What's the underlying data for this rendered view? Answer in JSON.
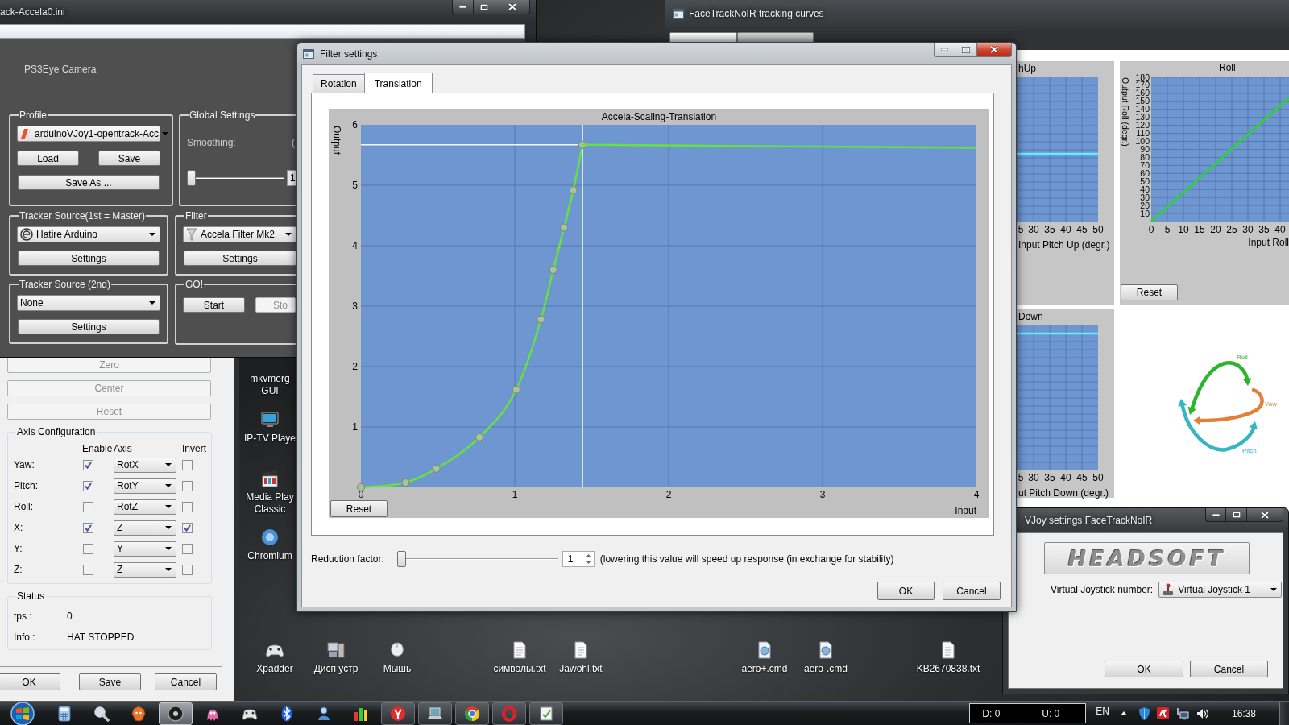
{
  "main_window": {
    "title": "ack-Accela0.ini",
    "camera_label": "PS3Eye Camera",
    "profile": {
      "label": "Profile",
      "dropdown": "arduinoVJoy1-opentrack-Acc",
      "buttons": [
        "Load",
        "Save",
        "Save As ..."
      ]
    },
    "global_settings": {
      "label": "Global Settings",
      "smoothing_label": "Smoothing:",
      "unit_label": "(",
      "slider": {
        "level": 0
      },
      "spin_value": "1"
    },
    "tracker_source_1": {
      "label": "Tracker Source(1st = Master)",
      "dropdown": "Hatire Arduino",
      "button": "Settings"
    },
    "filter": {
      "label": "Filter",
      "dropdown": "Accela Filter Mk2",
      "button": "Settings"
    },
    "tracker_source_2": {
      "label": "Tracker Source (2nd)",
      "dropdown": "None",
      "button": "Settings"
    },
    "go": {
      "label": "GO!",
      "buttons": [
        {
          "label": "Start",
          "disabled": false
        },
        {
          "label": "Sto",
          "disabled": true
        }
      ]
    }
  },
  "hat_window": {
    "buttons": [
      {
        "label": "Zero",
        "disabled": true
      },
      {
        "label": "Center",
        "disabled": true
      },
      {
        "label": "Reset",
        "disabled": true
      }
    ],
    "axis_configuration": {
      "label": "Axis Configuration",
      "columns": [
        "Enable",
        "Axis",
        "Invert"
      ],
      "rows": [
        {
          "name": "Yaw:",
          "enabled": true,
          "axis": "RotX",
          "inverted": false
        },
        {
          "name": "Pitch:",
          "enabled": true,
          "axis": "RotY",
          "inverted": false
        },
        {
          "name": "Roll:",
          "enabled": false,
          "axis": "RotZ",
          "inverted": false
        },
        {
          "name": "X:",
          "enabled": true,
          "axis": "Z",
          "inverted": true
        },
        {
          "name": "Y:",
          "enabled": false,
          "axis": "Y",
          "inverted": false
        },
        {
          "name": "Z:",
          "enabled": false,
          "axis": "Z",
          "inverted": false
        }
      ]
    },
    "status": {
      "label": "Status",
      "rows": [
        {
          "name": "tps :",
          "value": "0"
        },
        {
          "name": "Info :",
          "value": "HAT STOPPED"
        }
      ]
    },
    "footer_buttons": [
      "OK",
      "Save",
      "Cancel"
    ]
  },
  "filter_dialog": {
    "title": "Filter settings",
    "tabs": [
      {
        "label": "Rotation",
        "selected": false
      },
      {
        "label": "Translation",
        "selected": true
      }
    ],
    "chart": {
      "reset_button": "Reset",
      "chart_data": {
        "type": "line",
        "title": "Accela-Scaling-Translation",
        "xlabel": "Input",
        "ylabel": "Output",
        "x": [
          0,
          0.29,
          0.49,
          0.77,
          1.01,
          1.17,
          1.25,
          1.32,
          1.38,
          1.44,
          4
        ],
        "series": [
          {
            "color": "#66e23c",
            "marker": "circle",
            "values": [
              0,
              0.08,
              0.31,
              0.83,
              1.62,
              2.78,
              3.6,
              4.3,
              4.92,
              5.67,
              null
            ]
          },
          {
            "color": "#66e23c",
            "values": [
              null,
              null,
              null,
              null,
              null,
              null,
              null,
              null,
              null,
              5.67,
              5.62
            ]
          }
        ],
        "xlim": [
          0,
          4
        ],
        "ylim": [
          0,
          6
        ],
        "xticks": [
          0,
          1,
          2,
          3,
          4
        ],
        "yticks": [
          1,
          2,
          3,
          4,
          5,
          6
        ],
        "grid": true,
        "ref_lines": [
          {
            "axis": "x",
            "value": 1.44
          },
          {
            "axis": "y",
            "value": 5.67
          }
        ]
      }
    },
    "reduction": {
      "label": "Reduction factor:",
      "slider": {
        "level": 0
      },
      "spin_value": "1",
      "hint": "(lowering this value will speed up response (in exchange for stability)"
    },
    "buttons": [
      "OK",
      "Cancel"
    ]
  },
  "curves_window": {
    "title": "FaceTrackNoIR tracking curves",
    "tabs": [
      {
        "selected": true
      },
      {
        "selected": false
      }
    ],
    "pitch_up": {
      "title": "hUp",
      "x_tick_labels": [
        "5",
        "30",
        "35",
        "40",
        "45",
        "50"
      ],
      "xlabel": "Input Pitch Up (degr.)"
    },
    "roll": {
      "reset_button": "Reset",
      "chart_data": {
        "type": "line",
        "title": "Roll",
        "xlabel": "Input Roll",
        "ylabel": "Output Roll (degr.)",
        "x": [
          0,
          42.75
        ],
        "series": [
          {
            "color": "#33cc44",
            "values": [
              0,
              155
            ]
          }
        ],
        "xlim": [
          0,
          42.75
        ],
        "ylim": [
          0,
          180
        ],
        "xticks": [
          0,
          5,
          10,
          15,
          20,
          25,
          30,
          35,
          40
        ],
        "yticks": [
          10,
          20,
          30,
          40,
          50,
          60,
          70,
          80,
          90,
          100,
          110,
          120,
          130,
          140,
          150,
          160,
          170,
          180
        ],
        "grid": true
      }
    },
    "pitch_down": {
      "title": "Down",
      "x_tick_labels": [
        "5",
        "30",
        "35",
        "40",
        "45",
        "50"
      ],
      "xlabel": "ut Pitch Down (degr.)"
    },
    "axes_diagram": [
      {
        "label": "Roll",
        "color": "#2db52d"
      },
      {
        "label": "Yaw",
        "color": "#e2803a"
      },
      {
        "label": "Pitch",
        "color": "#35b6c2"
      }
    ]
  },
  "vjoy_window": {
    "title": "VJoy settings FaceTrackNoIR",
    "logo": "HEADSOFT",
    "joystick_label": "Virtual Joystick number:",
    "joystick_dropdown": "Virtual Joystick 1",
    "buttons": [
      "OK",
      "Cancel"
    ]
  },
  "desktop": {
    "column_icons": [
      {
        "label_lines": [
          "mkvmerg",
          "GUI"
        ]
      },
      {
        "kind": "monitor",
        "label_lines": [
          "IP-TV Playe"
        ]
      },
      {
        "kind": "clapper",
        "label_lines": [
          "Media Play",
          "Classic"
        ]
      },
      {
        "kind": "sphere",
        "label_lines": [
          "Chromium"
        ]
      }
    ],
    "row_icons": [
      {
        "kind": "gamepad",
        "label_lines": [
          "Xpadder"
        ]
      },
      {
        "kind": "computer",
        "label_lines": [
          "Дисп устр"
        ]
      },
      {
        "kind": "mouse",
        "label_lines": [
          "Мышь"
        ]
      },
      {
        "kind": "text-file",
        "label_lines": [
          "символы.txt"
        ]
      },
      {
        "kind": "text-file",
        "label_lines": [
          "Jawohl.txt"
        ]
      },
      {
        "kind": "script-file",
        "label_lines": [
          "aero+.cmd"
        ]
      },
      {
        "kind": "script-file",
        "label_lines": [
          "aero-.cmd"
        ]
      },
      {
        "kind": "text-file",
        "label_lines": [
          "KB2670838.txt"
        ]
      }
    ]
  },
  "taskbar": {
    "buttons": [
      {
        "kind": "calculator",
        "running": false,
        "selected": false
      },
      {
        "kind": "magnifier",
        "running": false,
        "selected": false
      },
      {
        "kind": "animal",
        "running": false,
        "selected": false
      },
      {
        "kind": "disc",
        "running": true,
        "selected": true
      },
      {
        "kind": "octopus",
        "running": false,
        "selected": false
      },
      {
        "kind": "gamepad",
        "running": false,
        "selected": false
      },
      {
        "kind": "bluetooth",
        "running": false,
        "selected": false
      },
      {
        "kind": "user",
        "running": false,
        "selected": false
      },
      {
        "kind": "bars",
        "running": false,
        "selected": false
      },
      {
        "kind": "circle-y",
        "running": true,
        "selected": false
      },
      {
        "kind": "laptop",
        "running": true,
        "selected": false
      },
      {
        "kind": "wheel",
        "running": true,
        "selected": false
      },
      {
        "kind": "ring",
        "running": true,
        "selected": false
      },
      {
        "kind": "notepad",
        "running": true,
        "selected": false
      }
    ],
    "net_meter": {
      "down": "D: 0",
      "up": "U: 0"
    },
    "language": "EN",
    "clock": "16:38"
  }
}
